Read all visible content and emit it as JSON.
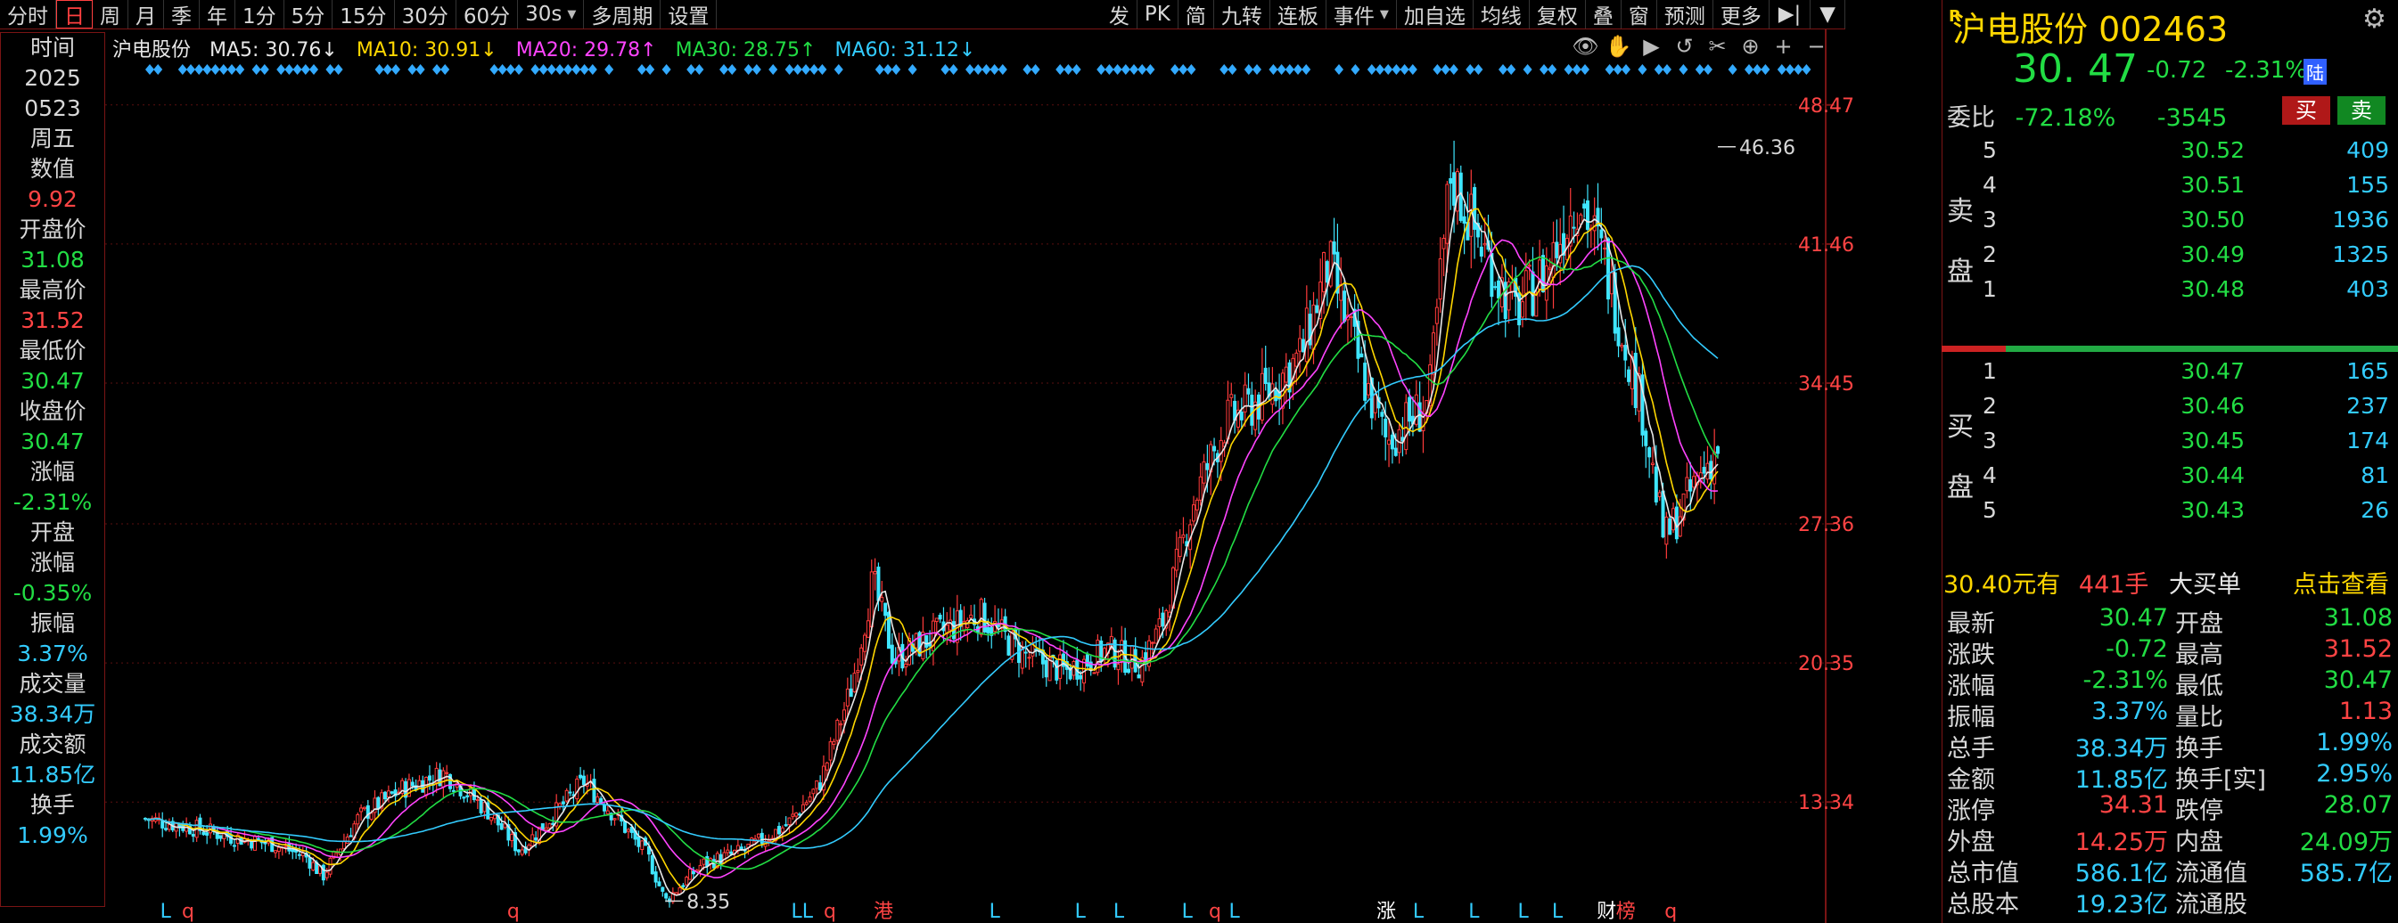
{
  "toolbar": {
    "left": [
      "分时",
      "日",
      "周",
      "月",
      "季",
      "年",
      "1分",
      "5分",
      "15分",
      "30分",
      "60分"
    ],
    "active": "日",
    "interval": "30s",
    "multi_period": "多周期",
    "settings": "设置",
    "right": [
      "发",
      "PK",
      "简",
      "九转",
      "连板",
      "事件",
      "加自选",
      "均线",
      "复权",
      "叠",
      "窗",
      "预测",
      "更多"
    ]
  },
  "left_panel": {
    "rows": [
      {
        "label": "时间"
      },
      {
        "label": "2025"
      },
      {
        "label": "0523"
      },
      {
        "label": "周五"
      },
      {
        "label": "数值"
      },
      {
        "value": "9.92",
        "color": "red"
      },
      {
        "label": "开盘价"
      },
      {
        "value": "31.08",
        "color": "green"
      },
      {
        "label": "最高价"
      },
      {
        "value": "31.52",
        "color": "red"
      },
      {
        "label": "最低价"
      },
      {
        "value": "30.47",
        "color": "green"
      },
      {
        "label": "收盘价"
      },
      {
        "value": "30.47",
        "color": "green"
      },
      {
        "label": "涨幅"
      },
      {
        "value": "-2.31%",
        "color": "green"
      },
      {
        "label": "开盘"
      },
      {
        "label": "涨幅"
      },
      {
        "value": "-0.35%",
        "color": "green"
      },
      {
        "label": "振幅"
      },
      {
        "value": "3.37%",
        "color": "cyan"
      },
      {
        "label": "成交量"
      },
      {
        "value": "38.34万",
        "color": "cyan"
      },
      {
        "label": "成交额"
      },
      {
        "value": "11.85亿",
        "color": "cyan"
      },
      {
        "label": "换手"
      },
      {
        "value": "1.99%",
        "color": "cyan"
      }
    ]
  },
  "ma_legend": {
    "stock": "沪电股份",
    "ma5": "MA5: 30.76↓",
    "ma10": "MA10: 30.91↓",
    "ma20": "MA20: 29.78↑",
    "ma30": "MA30: 28.75↑",
    "ma60": "MA60: 31.12↓"
  },
  "chart_tools": [
    "👁",
    "✋",
    "▶",
    "↺",
    "✂",
    "⊕",
    "+",
    "−"
  ],
  "chart_data": {
    "type": "candlestick",
    "y_ticks": [
      "48.47",
      "41.46",
      "34.45",
      "27.36",
      "20.35",
      "13.34"
    ],
    "y_tick_values": [
      48.47,
      41.46,
      34.45,
      27.36,
      20.35,
      13.34
    ],
    "ylim": [
      7.2,
      50.3
    ],
    "annotations": [
      {
        "text": "46.36",
        "value": 46.36,
        "x_frac": 0.735
      },
      {
        "text": "8.35",
        "value": 8.35,
        "x_frac": 0.243
      }
    ],
    "bottom_markers": [
      {
        "t": "L",
        "x": 0.0095,
        "c": "#33ccff"
      },
      {
        "t": "q",
        "x": 0.02,
        "c": "#ff4444"
      },
      {
        "t": "q",
        "x": 0.172,
        "c": "#ff4444"
      },
      {
        "t": "LL",
        "x": 0.307,
        "c": "#33ccff"
      },
      {
        "t": "q",
        "x": 0.32,
        "c": "#ff4444"
      },
      {
        "t": "港",
        "x": 0.345,
        "c": "#ff4444"
      },
      {
        "t": "L",
        "x": 0.397,
        "c": "#33ccff"
      },
      {
        "t": "L",
        "x": 0.437,
        "c": "#33ccff"
      },
      {
        "t": "L",
        "x": 0.455,
        "c": "#33ccff"
      },
      {
        "t": "L",
        "x": 0.487,
        "c": "#33ccff"
      },
      {
        "t": "q",
        "x": 0.5,
        "c": "#ff4444"
      },
      {
        "t": "L",
        "x": 0.509,
        "c": "#33ccff"
      },
      {
        "t": "涨",
        "x": 0.58,
        "c": "#ffffff"
      },
      {
        "t": "L",
        "x": 0.595,
        "c": "#33ccff"
      },
      {
        "t": "L",
        "x": 0.621,
        "c": "#33ccff"
      },
      {
        "t": "L",
        "x": 0.644,
        "c": "#33ccff"
      },
      {
        "t": "L",
        "x": 0.66,
        "c": "#33ccff"
      },
      {
        "t": "财",
        "x": 0.683,
        "c": "#ffffff"
      },
      {
        "t": "榜",
        "x": 0.692,
        "c": "#ff4444"
      },
      {
        "t": "q",
        "x": 0.713,
        "c": "#ff4444"
      }
    ],
    "path": [
      [
        0,
        12.5
      ],
      [
        0.02,
        12.1
      ],
      [
        0.04,
        11.6
      ],
      [
        0.06,
        11.2
      ],
      [
        0.075,
        10.6
      ],
      [
        0.083,
        9.6
      ],
      [
        0.09,
        10.9
      ],
      [
        0.1,
        12.6
      ],
      [
        0.12,
        14.0
      ],
      [
        0.14,
        14.8
      ],
      [
        0.16,
        12.9
      ],
      [
        0.175,
        10.9
      ],
      [
        0.19,
        12.6
      ],
      [
        0.205,
        14.4
      ],
      [
        0.22,
        12.6
      ],
      [
        0.235,
        10.6
      ],
      [
        0.243,
        8.35
      ],
      [
        0.26,
        10.2
      ],
      [
        0.28,
        10.9
      ],
      [
        0.3,
        12.2
      ],
      [
        0.315,
        14.2
      ],
      [
        0.33,
        19.1
      ],
      [
        0.34,
        24.5
      ],
      [
        0.35,
        20.5
      ],
      [
        0.37,
        21.8
      ],
      [
        0.39,
        22.8
      ],
      [
        0.41,
        20.8
      ],
      [
        0.43,
        19.9
      ],
      [
        0.45,
        21.0
      ],
      [
        0.465,
        20.3
      ],
      [
        0.475,
        22.2
      ],
      [
        0.49,
        28.5
      ],
      [
        0.505,
        32.5
      ],
      [
        0.52,
        33.5
      ],
      [
        0.54,
        35.8
      ],
      [
        0.553,
        40.5
      ],
      [
        0.57,
        34.5
      ],
      [
        0.58,
        31.5
      ],
      [
        0.6,
        33.5
      ],
      [
        0.61,
        45.0
      ],
      [
        0.622,
        42.0
      ],
      [
        0.64,
        38.0
      ],
      [
        0.655,
        40.2
      ],
      [
        0.67,
        44.0
      ],
      [
        0.682,
        40.5
      ],
      [
        0.7,
        33.0
      ],
      [
        0.71,
        26.5
      ],
      [
        0.725,
        29.5
      ],
      [
        0.735,
        31.2
      ]
    ],
    "ma_series": [
      {
        "color": "#e8e8e8",
        "lag": 1
      },
      {
        "color": "#ffd700",
        "lag": 2
      },
      {
        "color": "#ff44ff",
        "lag": 4
      },
      {
        "color": "#22dd44",
        "lag": 6
      },
      {
        "color": "#33ccff",
        "lag": 12
      }
    ]
  },
  "right_panel": {
    "r_badge": "R",
    "title": "沪电股份 002463",
    "price": "30. 47",
    "change": "-0.72",
    "pct": "-2.31%",
    "market_badge": "陆",
    "weibi_label": "委比",
    "weibi_pct": "-72.18%",
    "weibi_diff": "-3545",
    "buy": "买",
    "sell": "卖",
    "sell_side_chars": [
      "卖",
      "盘"
    ],
    "buy_side_chars": [
      "买",
      "盘"
    ],
    "asks": [
      {
        "lvl": "5",
        "px": "30.52",
        "vol": "409"
      },
      {
        "lvl": "4",
        "px": "30.51",
        "vol": "155"
      },
      {
        "lvl": "3",
        "px": "30.50",
        "vol": "1936"
      },
      {
        "lvl": "2",
        "px": "30.49",
        "vol": "1325"
      },
      {
        "lvl": "1",
        "px": "30.48",
        "vol": "403"
      }
    ],
    "bids": [
      {
        "lvl": "1",
        "px": "30.47",
        "vol": "165"
      },
      {
        "lvl": "2",
        "px": "30.46",
        "vol": "237"
      },
      {
        "lvl": "3",
        "px": "30.45",
        "vol": "174"
      },
      {
        "lvl": "4",
        "px": "30.44",
        "vol": "81"
      },
      {
        "lvl": "5",
        "px": "30.43",
        "vol": "26"
      }
    ],
    "big_bar": {
      "price": "30.40元有",
      "lots": "441手",
      "label": "大买单",
      "action": "点击查看"
    },
    "stats": [
      {
        "k": "最新",
        "v": "30.47",
        "c": "g",
        "k2": "开盘",
        "v2": "31.08",
        "c2": "g"
      },
      {
        "k": "涨跌",
        "v": "-0.72",
        "c": "g",
        "k2": "最高",
        "v2": "31.52",
        "c2": "r"
      },
      {
        "k": "涨幅",
        "v": "-2.31%",
        "c": "g",
        "k2": "最低",
        "v2": "30.47",
        "c2": "g"
      },
      {
        "k": "振幅",
        "v": "3.37%",
        "c": "c",
        "k2": "量比",
        "v2": "1.13",
        "c2": "r"
      },
      {
        "k": "总手",
        "v": "38.34万",
        "c": "c",
        "k2": "换手",
        "v2": "1.99%",
        "c2": "c"
      },
      {
        "k": "金额",
        "v": "11.85亿",
        "c": "c",
        "k2": "换手[实]",
        "v2": "2.95%",
        "c2": "c"
      },
      {
        "k": "涨停",
        "v": "34.31",
        "c": "r",
        "k2": "跌停",
        "v2": "28.07",
        "c2": "g"
      },
      {
        "k": "外盘",
        "v": "14.25万",
        "c": "r",
        "k2": "内盘",
        "v2": "24.09万",
        "c2": "g"
      },
      {
        "k": "总市值",
        "v": "586.1亿",
        "c": "c",
        "k2": "流通值",
        "v2": "585.7亿",
        "c2": "c"
      },
      {
        "k": "总股本",
        "v": "19.23亿",
        "c": "c",
        "k2": "流通股",
        "v2": "",
        "c2": "c"
      }
    ]
  }
}
